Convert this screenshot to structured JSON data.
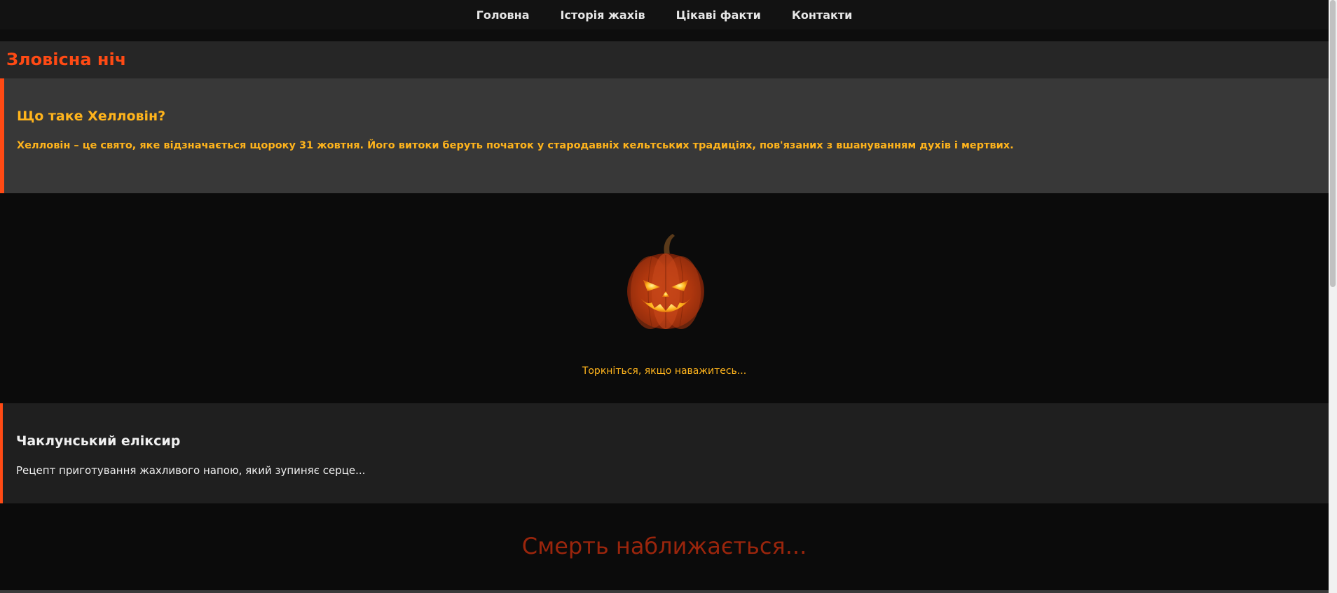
{
  "nav": {
    "items": [
      {
        "label": "Головна"
      },
      {
        "label": "Історія жахів"
      },
      {
        "label": "Цікаві факти"
      },
      {
        "label": "Контакти"
      }
    ]
  },
  "header": {
    "title": "Зловісна ніч"
  },
  "intro": {
    "heading": "Що таке Хелловін?",
    "text": "Хелловін – це свято, яке відзначається щороку 31 жовтня. Його витоки беруть початок у стародавніх кельтських традиціях, пов'язаних з вшануванням духів і мертвих."
  },
  "pumpkin": {
    "icon": "jack-o-lantern-icon",
    "caption": "Торкніться, якщо наважитесь..."
  },
  "elixir": {
    "heading": "Чаклунський еліксир",
    "text": "Рецепт приготування жахливого напою, який зупиняє серце..."
  },
  "footer": {
    "text": "Смерть наближається..."
  },
  "colors": {
    "accent": "#ff4a14",
    "gold": "#ffb41c",
    "death": "#9a250c",
    "background": "#0b0b0b"
  }
}
